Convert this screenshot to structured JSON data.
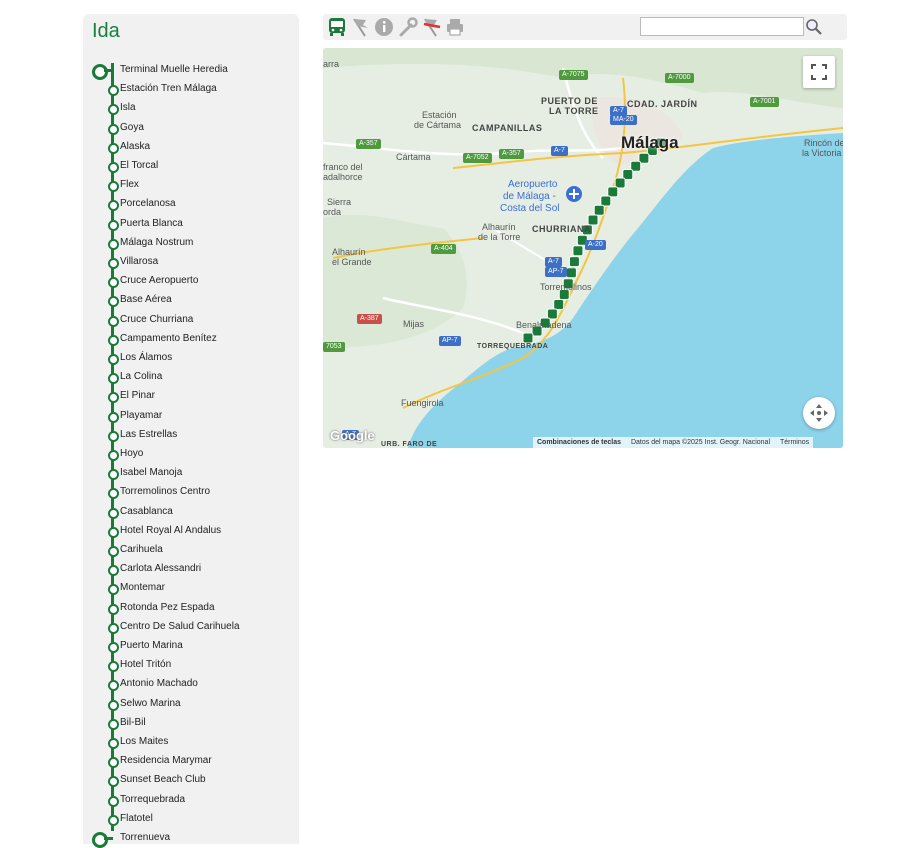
{
  "panel": {
    "title": "Ida",
    "stops": [
      "Terminal Muelle Heredia",
      "Estación Tren Málaga",
      "Isla",
      "Goya",
      "Alaska",
      "El Torcal",
      "Flex",
      "Porcelanosa",
      "Puerta Blanca",
      "Málaga Nostrum",
      "Villarosa",
      "Cruce Aeropuerto",
      "Base Aérea",
      "Cruce Churriana",
      "Campamento Benítez",
      "Los Álamos",
      "La Colina",
      "El Pinar",
      "Playamar",
      "Las Estrellas",
      "Hoyo",
      "Isabel Manoja",
      "Torremolinos Centro",
      "Casablanca",
      "Hotel Royal Al Andalus",
      "Carihuela",
      "Carlota Alessandri",
      "Montemar",
      "Rotonda Pez Espada",
      "Centro De Salud Carihuela",
      "Puerto Marina",
      "Hotel Tritón",
      "Antonio Machado",
      "Selwo Marina",
      "Bil-Bil",
      "Los Maites",
      "Residencia Marymar",
      "Sunset Beach Club",
      "Torrequebrada",
      "Flatotel",
      "Torrenueva"
    ]
  },
  "toolbar": {
    "icons": [
      "bus-icon",
      "flag-icon",
      "info-icon",
      "wrench-icon",
      "alert-flag-icon",
      "print-icon"
    ],
    "search_placeholder": "",
    "search_icon": "magnifier-icon"
  },
  "map": {
    "labels": {
      "malaga": "Málaga",
      "puerto_torre_1": "PUERTO DE",
      "puerto_torre_2": "LA TORRE",
      "cdad_jardin": "CDAD. JARDÍN",
      "campanillas": "CAMPANILLAS",
      "estacion_cartama_1": "Estación",
      "estacion_cartama_2": "de Cártama",
      "cartama": "Cártama",
      "arra": "arra",
      "alhaurin_torre_1": "Alhaurín",
      "alhaurin_torre_2": "de la Torre",
      "alhaurin_grande_1": "Alhaurín",
      "alhaurin_grande_2": "el Grande",
      "sierra_1": "Sierra",
      "sierra_2": "orda",
      "franco_1": "franco del",
      "franco_2": "adalhorce",
      "aeropuerto_1": "Aeropuerto",
      "aeropuerto_2": "de Málaga -",
      "aeropuerto_3": "Costa del Sol",
      "churriana": "CHURRIANA",
      "torremolinos": "Torremolinos",
      "benalmadena": "Benalmádena",
      "torrequebrada": "TORREQUEBRADA",
      "mijas": "Mijas",
      "fuengirola": "Fuengirola",
      "rincon_1": "Rincón de",
      "rincon_2": "la Victoria",
      "urb_faro": "URB. FARO DE"
    },
    "roads": {
      "a7075": "A-7075",
      "a7000": "A-7000",
      "a7001": "A-7001",
      "a7": "A-7",
      "ma20": "MA-20",
      "a357a": "A-357",
      "a7052": "A-7052",
      "a357b": "A-357",
      "a7b": "A-7",
      "a404": "A-404",
      "a387": "A-387",
      "a7053": "7053",
      "ap7": "AP-7",
      "a7c": "A-7",
      "ap7b": "AP-7",
      "a20": "A-20",
      "a7d": "A-7"
    },
    "footer": {
      "keyboard": "Combinaciones de teclas",
      "data": "Datos del mapa ©2025 Inst. Geogr. Nacional",
      "terms": "Términos"
    },
    "logo": "Google"
  },
  "colors": {
    "route": "#1b7a3a",
    "accent": "#16803c",
    "sea": "#8dd3ea",
    "land": "#e8efe6"
  }
}
